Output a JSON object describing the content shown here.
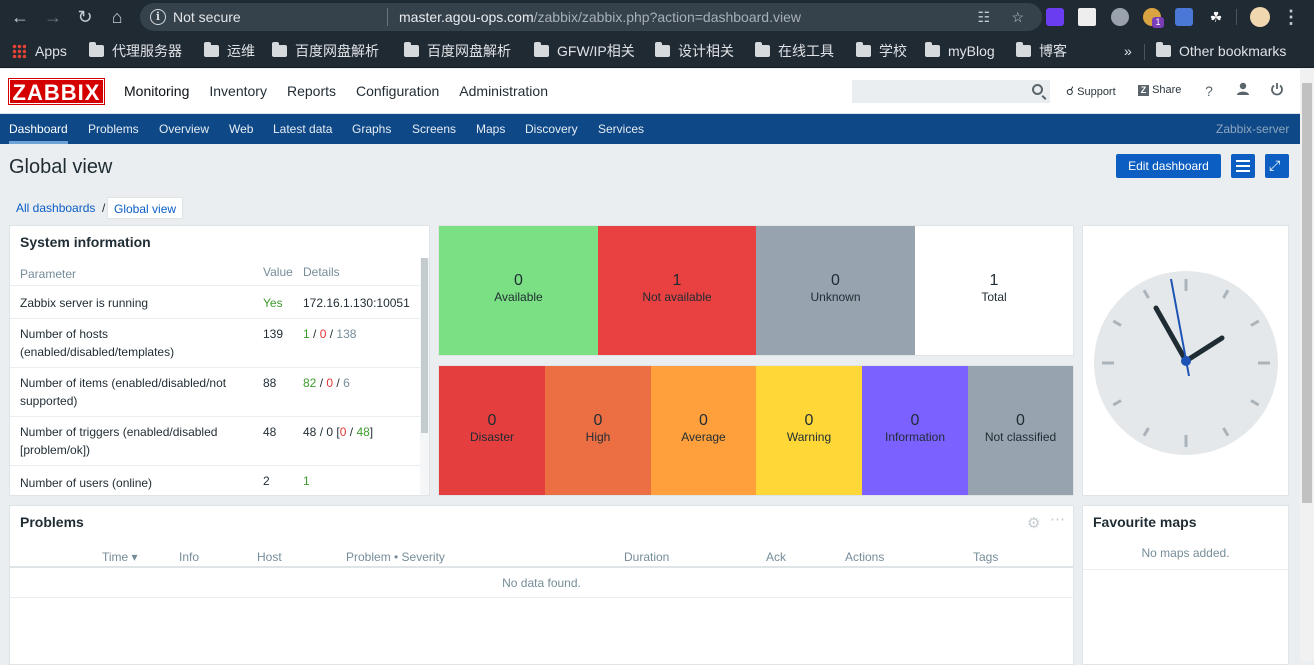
{
  "browser": {
    "not_secure": "Not secure",
    "url_host": "master.agou-ops.com",
    "url_path": "/zabbix/zabbix.php?action=dashboard.view",
    "bookmarks": [
      "Apps",
      "代理服务器",
      "运维",
      "百度网盘解析",
      "百度网盘解析",
      "GFW/IP相关",
      "设计相关",
      "在线工具",
      "学校",
      "myBlog",
      "博客"
    ],
    "more": "»",
    "other_bookmarks": "Other bookmarks",
    "extension_badge": "1"
  },
  "header": {
    "logo": "ZABBIX",
    "menu": [
      "Monitoring",
      "Inventory",
      "Reports",
      "Configuration",
      "Administration"
    ],
    "support": "Support",
    "share": "Share",
    "help": "?"
  },
  "subnav": {
    "items": [
      "Dashboard",
      "Problems",
      "Overview",
      "Web",
      "Latest data",
      "Graphs",
      "Screens",
      "Maps",
      "Discovery",
      "Services"
    ],
    "server": "Zabbix-server"
  },
  "page": {
    "title": "Global view",
    "edit_button": "Edit dashboard",
    "breadcrumb": [
      "All dashboards",
      "/",
      "Global view"
    ]
  },
  "system_info": {
    "title": "System information",
    "headers": [
      "Parameter",
      "Value",
      "Details"
    ],
    "rows": [
      {
        "param": "Zabbix server is running",
        "value": "Yes",
        "details": "172.16.1.130:10051"
      },
      {
        "param": "Number of hosts (enabled/disabled/templates)",
        "value": "139",
        "d1": "1",
        "d2": "0",
        "d3": "138"
      },
      {
        "param": "Number of items (enabled/disabled/not supported)",
        "value": "88",
        "d1": "82",
        "d2": "0",
        "d3": "6"
      },
      {
        "param": "Number of triggers (enabled/disabled [problem/ok])",
        "value": "48",
        "d1": "48",
        "d2": "0",
        "d3": "0",
        "d4": "48"
      },
      {
        "param": "Number of users (online)",
        "value": "2",
        "d1": "1"
      }
    ]
  },
  "host_availability": [
    {
      "count": "0",
      "label": "Available",
      "color": "#7ae083"
    },
    {
      "count": "1",
      "label": "Not available",
      "color": "#e94141"
    },
    {
      "count": "0",
      "label": "Unknown",
      "color": "#97a3ae"
    },
    {
      "count": "1",
      "label": "Total",
      "color": "#ffffff"
    }
  ],
  "problems_by_severity": [
    {
      "count": "0",
      "label": "Disaster",
      "color": "#e53e3e"
    },
    {
      "count": "0",
      "label": "High",
      "color": "#ec6f44"
    },
    {
      "count": "0",
      "label": "Average",
      "color": "#ffa03c"
    },
    {
      "count": "0",
      "label": "Warning",
      "color": "#ffd838"
    },
    {
      "count": "0",
      "label": "Information",
      "color": "#7b61ff"
    },
    {
      "count": "0",
      "label": "Not classified",
      "color": "#97a3ae"
    }
  ],
  "problems": {
    "title": "Problems",
    "columns": [
      "Time ▾",
      "Info",
      "Host",
      "Problem • Severity",
      "Duration",
      "Ack",
      "Actions",
      "Tags"
    ],
    "empty": "No data found."
  },
  "favourite_maps": {
    "title": "Favourite maps",
    "empty": "No maps added."
  }
}
